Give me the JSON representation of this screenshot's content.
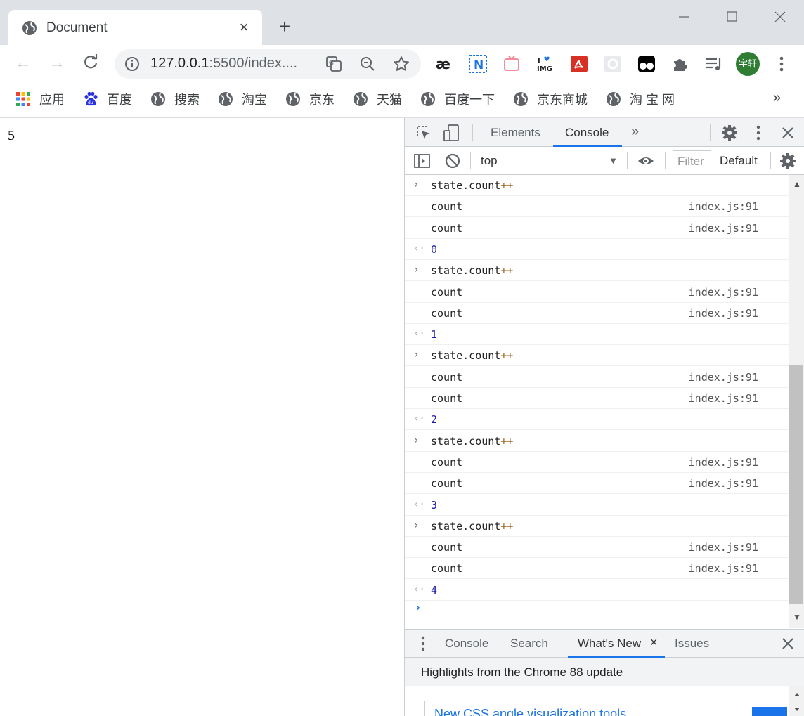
{
  "tab": {
    "title": "Document",
    "close": "×",
    "favicon": "globe-icon"
  },
  "newtab": "+",
  "window_controls": {
    "minimize": "—",
    "maximize": "☐",
    "close": "✕"
  },
  "nav": {
    "back": "←",
    "forward": "→",
    "reload": "⟳"
  },
  "omnibox": {
    "host": "127.0.0.1",
    "rest": ":5500/index...."
  },
  "bookmarks": [
    {
      "label": "应用",
      "icon": "apps-grid-icon"
    },
    {
      "label": "百度",
      "icon": "baidu-paw-icon"
    },
    {
      "label": "搜索",
      "icon": "globe-icon"
    },
    {
      "label": "淘宝",
      "icon": "globe-icon"
    },
    {
      "label": "京东",
      "icon": "globe-icon"
    },
    {
      "label": "天猫",
      "icon": "globe-icon"
    },
    {
      "label": "百度一下",
      "icon": "globe-icon"
    },
    {
      "label": "京东商城",
      "icon": "globe-icon"
    },
    {
      "label": "淘 宝 网",
      "icon": "globe-icon"
    }
  ],
  "bookmarks_more": "»",
  "avatar_text": "宇轩",
  "page": {
    "count": "5"
  },
  "devtools": {
    "tabs": {
      "elements": "Elements",
      "console": "Console",
      "more": "»"
    },
    "context": "top",
    "filter_placeholder": "Filter",
    "levels": "Default",
    "console_rows": [
      {
        "type": "input",
        "prefix": "›",
        "text": "state.count",
        "op": "++"
      },
      {
        "type": "log",
        "text": "count",
        "src": "index.js:91"
      },
      {
        "type": "log",
        "text": "count",
        "src": "index.js:91"
      },
      {
        "type": "result",
        "prefix": "‹·",
        "text": "0"
      },
      {
        "type": "input",
        "prefix": "›",
        "text": "state.count",
        "op": "++"
      },
      {
        "type": "log",
        "text": "count",
        "src": "index.js:91"
      },
      {
        "type": "log",
        "text": "count",
        "src": "index.js:91"
      },
      {
        "type": "result",
        "prefix": "‹·",
        "text": "1"
      },
      {
        "type": "input",
        "prefix": "›",
        "text": "state.count",
        "op": "++"
      },
      {
        "type": "log",
        "text": "count",
        "src": "index.js:91"
      },
      {
        "type": "log",
        "text": "count",
        "src": "index.js:91"
      },
      {
        "type": "result",
        "prefix": "‹·",
        "text": "2"
      },
      {
        "type": "input",
        "prefix": "›",
        "text": "state.count",
        "op": "++"
      },
      {
        "type": "log",
        "text": "count",
        "src": "index.js:91"
      },
      {
        "type": "log",
        "text": "count",
        "src": "index.js:91"
      },
      {
        "type": "result",
        "prefix": "‹·",
        "text": "3"
      },
      {
        "type": "input",
        "prefix": "›",
        "text": "state.count",
        "op": "++"
      },
      {
        "type": "log",
        "text": "count",
        "src": "index.js:91"
      },
      {
        "type": "log",
        "text": "count",
        "src": "index.js:91"
      },
      {
        "type": "result",
        "prefix": "‹·",
        "text": "4"
      }
    ],
    "prompt": "›",
    "drawer": {
      "tabs": [
        "Console",
        "Search",
        "What's New",
        "Issues"
      ],
      "active_close": "×",
      "close": "✕",
      "highlights": "Highlights from the Chrome 88 update",
      "card_title": "New CSS angle visualization tools"
    }
  },
  "colors": {
    "accent": "#1a73e8",
    "tabstrip": "#dee1e6",
    "devtools_bar": "#f1f3f4"
  }
}
